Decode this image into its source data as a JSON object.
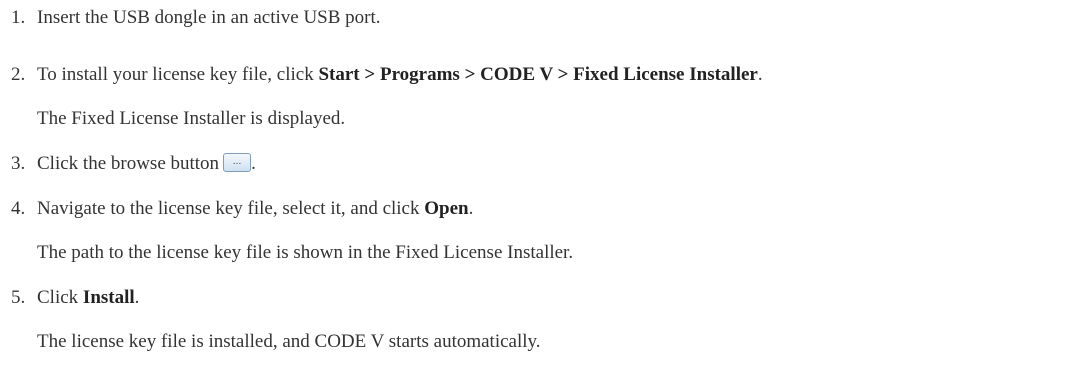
{
  "steps": [
    {
      "number": "1.",
      "text": "Insert the USB dongle in an active USB port."
    },
    {
      "number": "2.",
      "text_before": "To install your license key file, click ",
      "bold": "Start > Programs > CODE V > Fixed License Installer",
      "text_after": ".",
      "note": "The Fixed License Installer is displayed."
    },
    {
      "number": "3.",
      "text_before": "Click the browse button",
      "button_icon": "ellipsis-browse-icon",
      "button_glyph": "...",
      "text_after": "."
    },
    {
      "number": "4.",
      "text_before": "Navigate to the license key file, select it, and click ",
      "bold": "Open",
      "text_after": ".",
      "note": "The path to the license key file is shown in the Fixed License Installer."
    },
    {
      "number": "5.",
      "text_before": "Click ",
      "bold": "Install",
      "text_after": ".",
      "note": "The license key file is installed, and CODE V starts automatically."
    }
  ]
}
